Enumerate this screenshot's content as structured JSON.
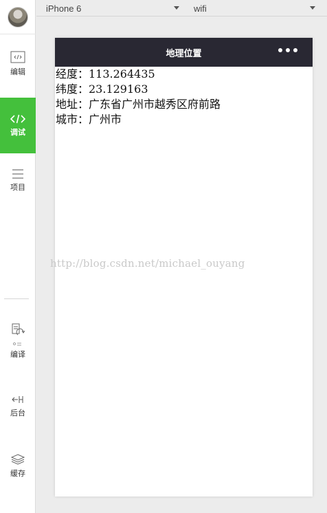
{
  "sidebar": {
    "items": [
      {
        "label": "编辑",
        "icon": "code-editor-icon",
        "active": false
      },
      {
        "label": "调试",
        "icon": "code-brackets-icon",
        "active": true
      },
      {
        "label": "项目",
        "icon": "menu-lines-icon",
        "active": false
      },
      {
        "label": "编译",
        "icon": "compile-refresh-icon",
        "active": false
      },
      {
        "label": "后台",
        "icon": "background-icon",
        "active": false
      },
      {
        "label": "缓存",
        "icon": "layers-icon",
        "active": false
      }
    ]
  },
  "toolbar": {
    "device": "iPhone 6",
    "network": "wifi"
  },
  "phone": {
    "title": "地理位置",
    "rows": [
      "经度：113.264435",
      "纬度：23.129163",
      "地址：广东省广州市越秀区府前路",
      "城市：广州市"
    ]
  },
  "watermark": "http://blog.csdn.net/michael_ouyang",
  "colors": {
    "active_green": "#44c03c",
    "phone_nav_bg": "#292833",
    "page_bg": "#ececec"
  }
}
